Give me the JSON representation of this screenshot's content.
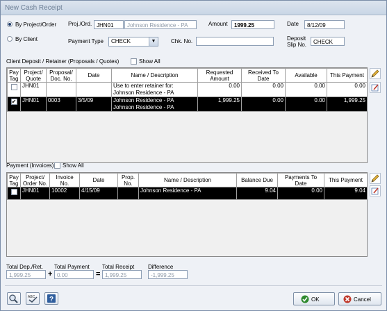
{
  "window": {
    "title": "New Cash Receipt"
  },
  "mode": {
    "by_project_label": "By Project/Order",
    "by_client_label": "By Client"
  },
  "header": {
    "proj_label": "Proj./Ord.",
    "proj_code": "JHN01",
    "proj_name": "Johnson Residence - PA",
    "amount_label": "Amount",
    "amount_value": "1999.25",
    "date_label": "Date",
    "date_value": "8/12/09",
    "payment_type_label": "Payment Type",
    "payment_type_value": "CHECK",
    "chk_no_label": "Chk. No.",
    "chk_no_value": "",
    "deposit_slip_label_1": "Deposit",
    "deposit_slip_label_2": "Slip No.",
    "deposit_slip_value": "CHECK"
  },
  "deposit_section": {
    "title": "Client Deposit / Retainer (Proposals / Quotes)",
    "show_all_label": "Show All",
    "columns": {
      "pay_tag_1": "Pay",
      "pay_tag_2": "Tag",
      "project_1": "Project/",
      "project_2": "Quote",
      "proposal_1": "Proposal/",
      "proposal_2": "Doc. No.",
      "date": "Date",
      "name": "Name / Description",
      "requested_1": "Requested",
      "requested_2": "Amount",
      "received_1": "Received To",
      "received_2": "Date",
      "available": "Available",
      "this_payment": "This Payment"
    },
    "rows": [
      {
        "checked": "",
        "project": "JHN01",
        "proposal": "",
        "date": "",
        "name_1": "Use to enter retainer for:",
        "name_2": "Johnson Residence - PA",
        "requested": "0.00",
        "received": "0.00",
        "available": "0.00",
        "this_payment": "0.00"
      },
      {
        "checked": "✔",
        "project": "JHN01",
        "proposal": "0003",
        "date": "3/5/09",
        "name_1": "Johnson Residence - PA",
        "name_2": "Johnson Residence - PA",
        "requested": "1,999.25",
        "received": "0.00",
        "available": "0.00",
        "this_payment": "1,999.25"
      }
    ]
  },
  "payment_section": {
    "title": "Payment (Invoices)",
    "show_all_label": "Show All",
    "columns": {
      "pay_tag_1": "Pay",
      "pay_tag_2": "Tag",
      "project_1": "Project/",
      "project_2": "Order No.",
      "invoice_1": "Invoice",
      "invoice_2": "No.",
      "date": "Date",
      "prop_1": "Prop.",
      "prop_2": "No.",
      "name": "Name / Description",
      "balance": "Balance Due",
      "payments_1": "Payments To",
      "payments_2": "Date",
      "this_payment": "This Payment"
    },
    "rows": [
      {
        "checked": "",
        "project": "JHN01",
        "invoice": "10002",
        "date": "4/15/09",
        "prop": "",
        "name": "Johnson Residence - PA",
        "balance": "9.04",
        "payments": "0.00",
        "this_payment": "9.04"
      }
    ]
  },
  "totals": {
    "dep_label": "Total Dep./Ret.",
    "dep_value": "1,999.25",
    "plus": "+",
    "payment_label": "Total Payment",
    "payment_value": "0.00",
    "equals": "=",
    "receipt_label": "Total Receipt",
    "receipt_value": "1,999.25",
    "diff_label": "Difference",
    "diff_value": "-1,999.25"
  },
  "buttons": {
    "ok_label": "OK",
    "cancel_label": "Cancel"
  },
  "colors": {
    "ok_check": "#2f8a2f",
    "cancel_x": "#c0392b",
    "selected_row": "#000000"
  }
}
